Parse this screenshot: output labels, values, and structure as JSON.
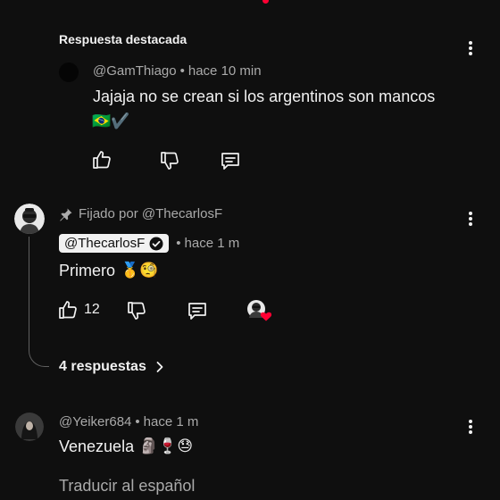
{
  "colors": {
    "background": "#0f0f0f",
    "text": "#f1f1f1",
    "muted": "#aaaaaa",
    "heart": "#ff0033"
  },
  "highlighted": {
    "title": "Respuesta destacada",
    "author": "@GamThiago",
    "time": "hace 10 min",
    "text": "Jajaja no se crean si los argentinos son mancos",
    "emoji": "🇧🇷✔️",
    "icons": [
      "like-icon",
      "dislike-icon",
      "reply-icon",
      "more-options-icon"
    ]
  },
  "pinned_comment": {
    "pinned_label": "Fijado por @ThecarlosF",
    "author": "@ThecarlosF",
    "time": "hace 1 m",
    "text": "Primero",
    "emoji": "🥇🧐",
    "likes": "12",
    "replies_label": "4 respuestas",
    "icons": [
      "pin-icon",
      "verified-icon",
      "like-icon",
      "dislike-icon",
      "reply-icon",
      "creator-heart-icon",
      "chevron-right-icon",
      "more-options-icon"
    ]
  },
  "comment": {
    "author": "@Yeiker684",
    "time": "hace 1 m",
    "text": "Venezuela",
    "emoji": "🗿🍷😓",
    "translate": "Traducir al español"
  }
}
